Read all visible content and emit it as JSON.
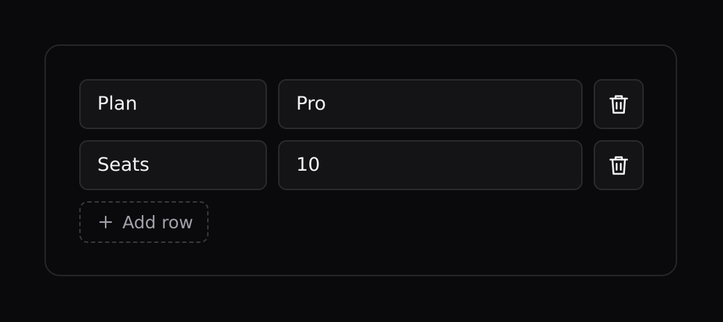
{
  "rows": [
    {
      "key": "Plan",
      "value": "Pro",
      "delete_icon": "trash-icon"
    },
    {
      "key": "Seats",
      "value": "10",
      "delete_icon": "trash-icon"
    }
  ],
  "add_row": {
    "label": "Add row",
    "icon": "plus-icon"
  },
  "colors": {
    "background": "#0a0a0c",
    "field_background": "#141416",
    "border": "#2b2b2f",
    "text": "#f4f4f5",
    "muted_text": "#a1a1aa"
  }
}
